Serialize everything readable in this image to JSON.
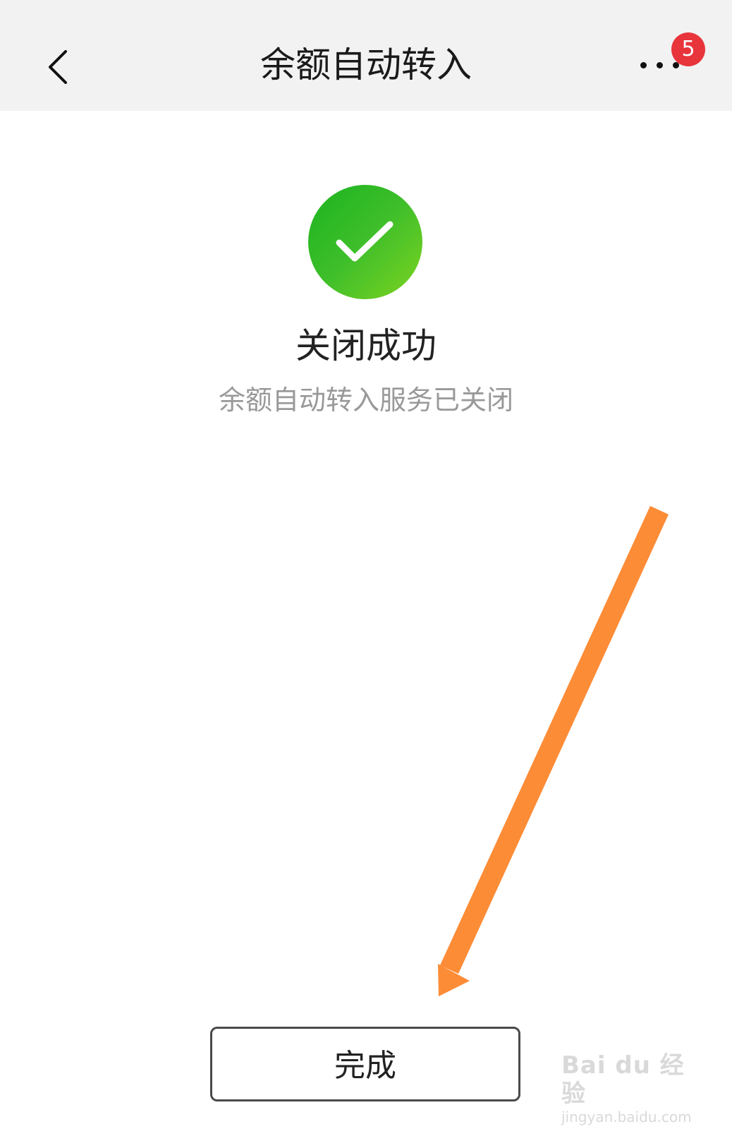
{
  "header": {
    "title": "余额自动转入",
    "back_icon": "chevron-left-icon",
    "more_icon": "more-dots-icon",
    "badge_count": "5"
  },
  "result": {
    "icon": "check-circle-icon",
    "icon_color": "#1db620",
    "title": "关闭成功",
    "subtitle": "余额自动转入服务已关闭"
  },
  "footer": {
    "done_label": "完成"
  },
  "annotation": {
    "arrow_color": "#fd8c37"
  },
  "watermark": {
    "brand": "Bai du 经验",
    "url": "jingyan.baidu.com"
  },
  "colors": {
    "nav_background": "#f2f2f2",
    "badge_red": "#e8343b",
    "subtitle_gray": "#999999"
  }
}
